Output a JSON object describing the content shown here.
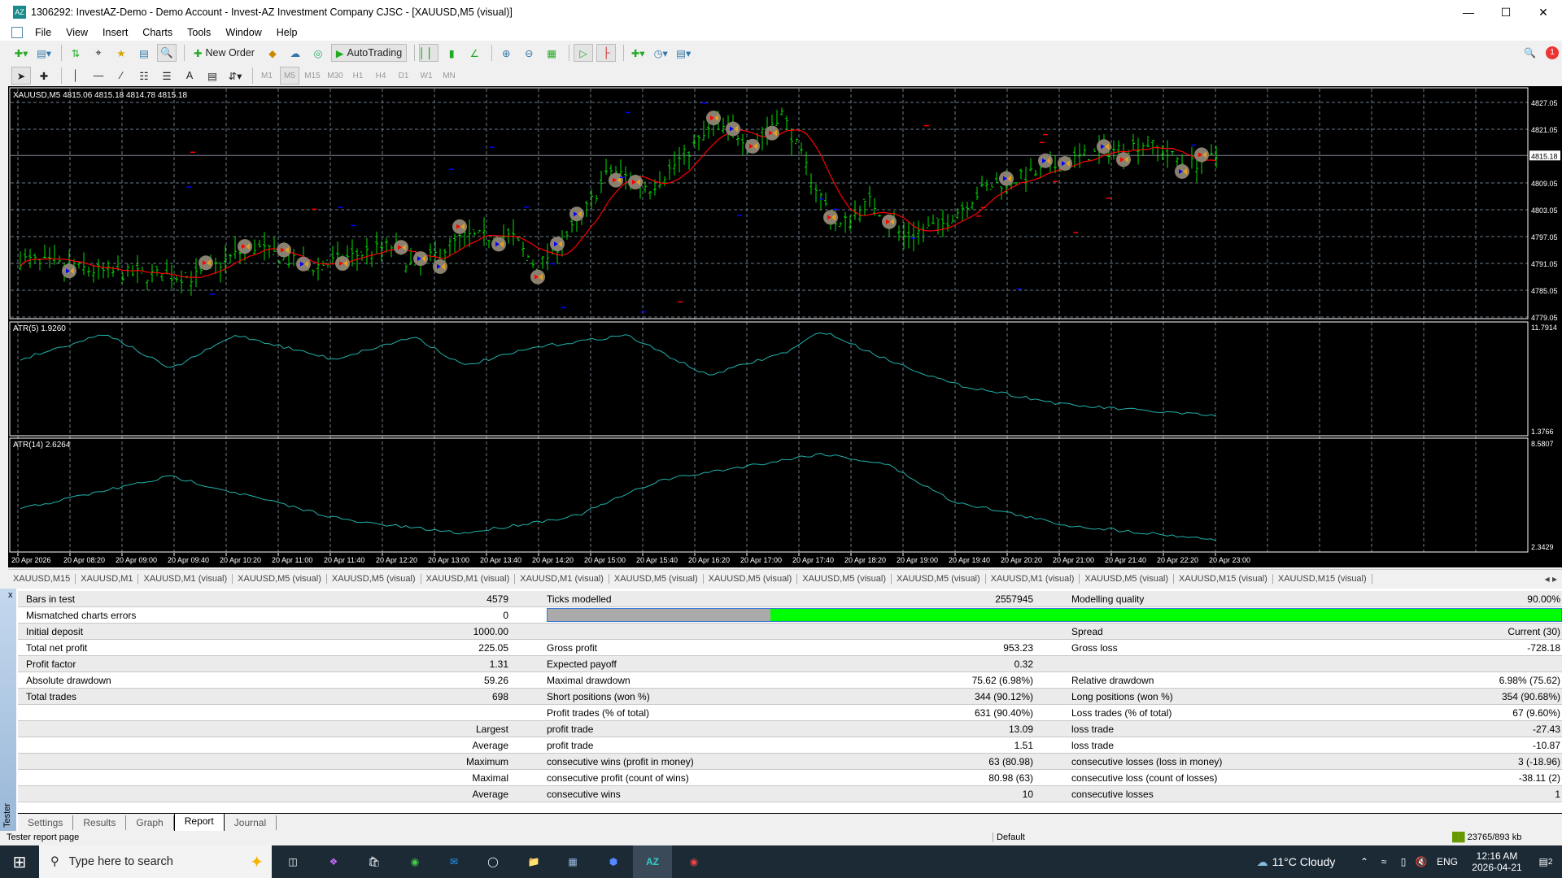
{
  "window": {
    "title": "1306292: InvestAZ-Demo - Demo Account - Invest-AZ Investment Company CJSC - [XAUUSD,M5 (visual)]",
    "logo_text": "AZ"
  },
  "menu": [
    "File",
    "View",
    "Insert",
    "Charts",
    "Tools",
    "Window",
    "Help"
  ],
  "toolbar": {
    "new_order": "New Order",
    "autotrading": "AutoTrading"
  },
  "timeframes": [
    "M1",
    "M5",
    "M15",
    "M30",
    "H1",
    "H4",
    "D1",
    "W1",
    "MN"
  ],
  "active_timeframe": "M5",
  "chart": {
    "header": "XAUUSD,M5  4815.06 4815.18 4814.78 4815.18",
    "price_ticks": [
      "4827.05",
      "4821.05",
      "4815.18",
      "4809.05",
      "4803.05",
      "4797.05",
      "4791.05",
      "4785.05",
      "4779.05"
    ],
    "current_price": "4815.18",
    "atr5": {
      "label": "ATR(5) 1.9260",
      "max": "11.7914",
      "min": "1.3766"
    },
    "atr14": {
      "label": "ATR(14) 2.6264",
      "max": "8.5807",
      "min": "2.3429"
    },
    "time_ticks": [
      "20 Apr 2026",
      "20 Apr 08:20",
      "20 Apr 09:00",
      "20 Apr 09:40",
      "20 Apr 10:20",
      "20 Apr 11:00",
      "20 Apr 11:40",
      "20 Apr 12:20",
      "20 Apr 13:00",
      "20 Apr 13:40",
      "20 Apr 14:20",
      "20 Apr 15:00",
      "20 Apr 15:40",
      "20 Apr 16:20",
      "20 Apr 17:00",
      "20 Apr 17:40",
      "20 Apr 18:20",
      "20 Apr 19:00",
      "20 Apr 19:40",
      "20 Apr 20:20",
      "20 Apr 21:00",
      "20 Apr 21:40",
      "20 Apr 22:20",
      "20 Apr 23:00"
    ],
    "colors": {
      "bars": "#00e000",
      "ma": "#ff0000",
      "atr": "#20b2aa",
      "grid": "#6a7a8a"
    }
  },
  "chart_tabs": [
    "XAUUSD,M15",
    "XAUUSD,M1",
    "XAUUSD,M1 (visual)",
    "XAUUSD,M5 (visual)",
    "XAUUSD,M5 (visual)",
    "XAUUSD,M1 (visual)",
    "XAUUSD,M1 (visual)",
    "XAUUSD,M5 (visual)",
    "XAUUSD,M5 (visual)",
    "XAUUSD,M5 (visual)",
    "XAUUSD,M5 (visual)",
    "XAUUSD,M1 (visual)",
    "XAUUSD,M5 (visual)",
    "XAUUSD,M15 (visual)",
    "XAUUSD,M15 (visual)"
  ],
  "tester": {
    "side_label": "Tester",
    "close": "x",
    "modelling_quality_percent": 90,
    "rows": [
      [
        "Bars in test",
        "4579",
        "Ticks modelled",
        "2557945",
        "Modelling quality",
        "90.00%"
      ],
      [
        "Mismatched charts errors",
        "0",
        "",
        "",
        "",
        ""
      ],
      [
        "Initial deposit",
        "1000.00",
        "",
        "",
        "Spread",
        "Current (30)"
      ],
      [
        "Total net profit",
        "225.05",
        "Gross profit",
        "953.23",
        "Gross loss",
        "-728.18"
      ],
      [
        "Profit factor",
        "1.31",
        "Expected payoff",
        "0.32",
        "",
        ""
      ],
      [
        "Absolute drawdown",
        "59.26",
        "Maximal drawdown",
        "75.62 (6.98%)",
        "Relative drawdown",
        "6.98% (75.62)"
      ],
      [
        "Total trades",
        "698",
        "Short positions (won %)",
        "344 (90.12%)",
        "Long positions (won %)",
        "354 (90.68%)"
      ],
      [
        "",
        "",
        "Profit trades (% of total)",
        "631 (90.40%)",
        "Loss trades (% of total)",
        "67 (9.60%)"
      ],
      [
        "",
        "Largest",
        "profit trade",
        "13.09",
        "loss trade",
        "-27.43"
      ],
      [
        "",
        "Average",
        "profit trade",
        "1.51",
        "loss trade",
        "-10.87"
      ],
      [
        "",
        "Maximum",
        "consecutive wins (profit in money)",
        "63 (80.98)",
        "consecutive losses (loss in money)",
        "3 (-18.96)"
      ],
      [
        "",
        "Maximal",
        "consecutive profit (count of wins)",
        "80.98 (63)",
        "consecutive loss (count of losses)",
        "-38.11 (2)"
      ],
      [
        "",
        "Average",
        "consecutive wins",
        "10",
        "consecutive losses",
        "1"
      ]
    ],
    "tabs": [
      "Settings",
      "Results",
      "Graph",
      "Report",
      "Journal"
    ],
    "active_tab": "Report"
  },
  "status": {
    "left": "Tester report page",
    "profile": "Default",
    "traffic": "23765/893 kb"
  },
  "taskbar": {
    "search": "Type here to search",
    "weather": "11°C  Cloudy",
    "lang": "ENG",
    "time": "12:16 AM",
    "date": "2026-04-21",
    "notifications": "2"
  }
}
